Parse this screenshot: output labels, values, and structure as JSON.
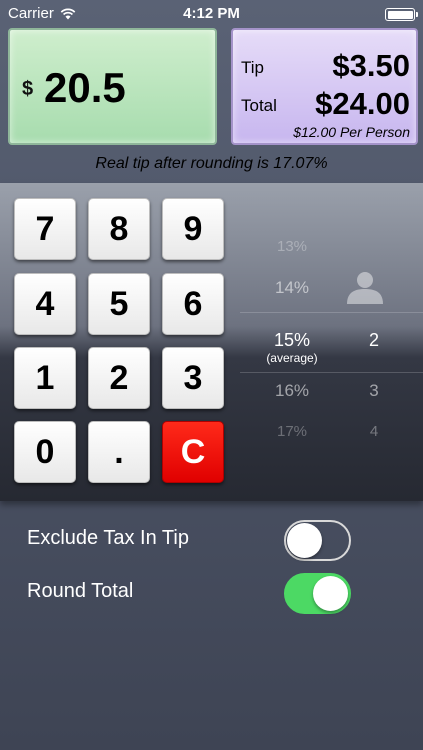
{
  "status_bar": {
    "carrier": "Carrier",
    "time": "4:12 PM"
  },
  "amount": {
    "currency_symbol": "$",
    "value": "20.5"
  },
  "summary": {
    "tip_label": "Tip",
    "tip_value": "$3.50",
    "total_label": "Total",
    "total_value": "$24.00",
    "per_person": "$12.00 Per Person"
  },
  "real_tip_text": "Real tip after rounding is 17.07%",
  "keypad": {
    "keys": [
      "7",
      "8",
      "9",
      "4",
      "5",
      "6",
      "1",
      "2",
      "3",
      "0",
      ".",
      "C"
    ]
  },
  "tip_picker": {
    "items": [
      "13%",
      "14%",
      "15%",
      "16%",
      "17%"
    ],
    "selected_sublabel": "(average)",
    "selected_index": 2
  },
  "people_picker": {
    "items": [
      "2",
      "3",
      "4"
    ],
    "selected_index": 0
  },
  "settings": {
    "exclude_tax_label": "Exclude Tax In Tip",
    "exclude_tax_on": false,
    "round_total_label": "Round Total",
    "round_total_on": true
  },
  "colors": {
    "clear_key": "#e00000",
    "toggle_on": "#4cd964",
    "amount_panel": "#b8e4bd",
    "tip_panel": "#d3c6f3"
  }
}
